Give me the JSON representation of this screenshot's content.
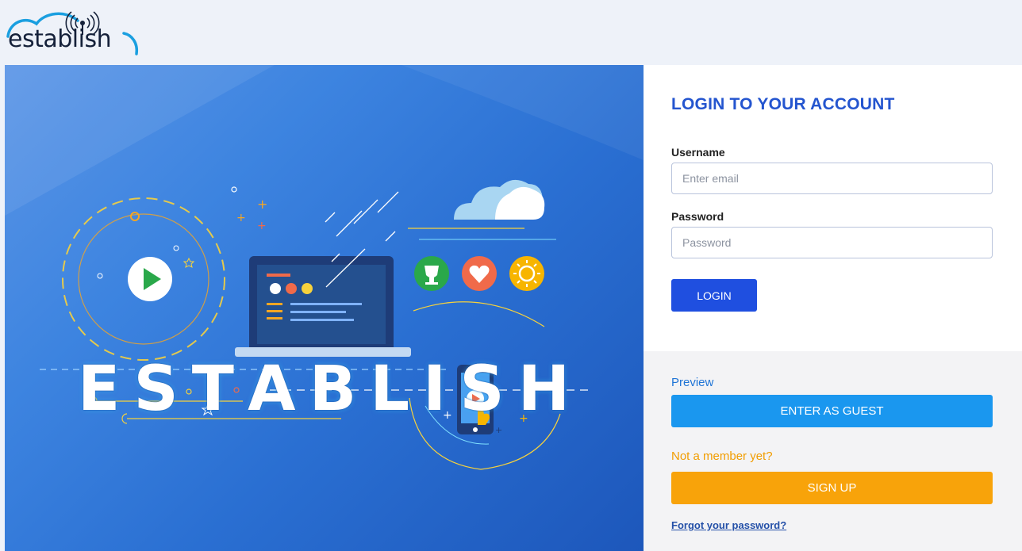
{
  "header": {
    "logo_text": "establish",
    "logo_icon": "cloud-signal-icon"
  },
  "hero": {
    "word_letters": [
      "E",
      "S",
      "T",
      "A",
      "B",
      "L",
      "I",
      "S",
      "H"
    ],
    "icons": [
      "play-icon",
      "cloud-icon",
      "trophy-icon",
      "heart-icon",
      "sun-icon",
      "laptop-icon",
      "phone-icon",
      "star-icon",
      "arrow-icon"
    ]
  },
  "login": {
    "title": "LOGIN TO YOUR ACCOUNT",
    "username_label": "Username",
    "username_placeholder": "Enter email",
    "username_value": "",
    "password_label": "Password",
    "password_placeholder": "Password",
    "password_value": "",
    "login_button": "LOGIN"
  },
  "alt_actions": {
    "preview_label": "Preview",
    "guest_button": "ENTER AS GUEST",
    "member_label": "Not a member yet?",
    "signup_button": "SIGN UP",
    "forgot_link": "Forgot your password?"
  },
  "colors": {
    "title": "#2455cf",
    "login_button": "#1f4fe0",
    "guest_button": "#1a97ef",
    "signup_button": "#f8a30a",
    "member_label": "#f29d00",
    "preview_label": "#1f74d6"
  }
}
